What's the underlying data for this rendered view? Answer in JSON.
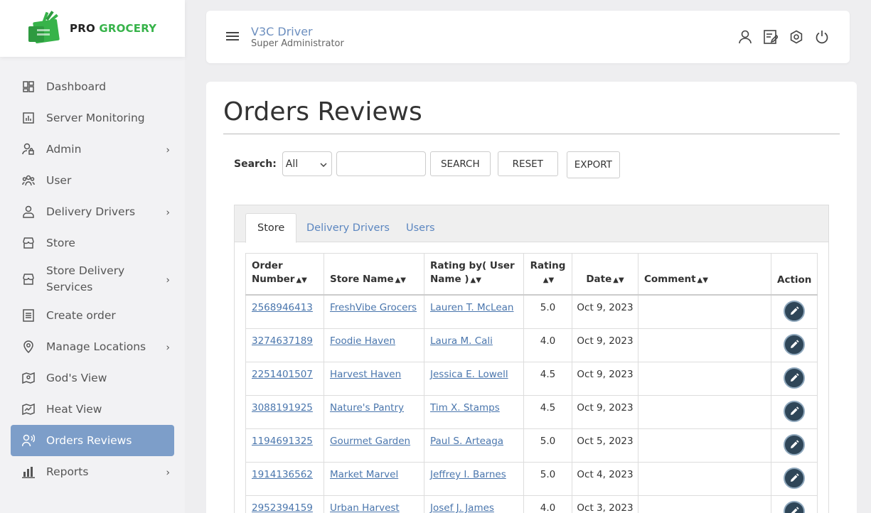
{
  "brand": {
    "word1": "PRO",
    "word2": "GROCERY",
    "color_green": "#37b34a"
  },
  "header": {
    "title": "V3C Driver",
    "subtitle": "Super Administrator",
    "icons": [
      "user-icon",
      "edit-note-icon",
      "settings-icon",
      "power-icon"
    ]
  },
  "sidebar": {
    "items": [
      {
        "label": "Dashboard",
        "icon": "dashboard-icon",
        "submenu": false
      },
      {
        "label": "Server Monitoring",
        "icon": "monitor-chart-icon",
        "submenu": false
      },
      {
        "label": "Admin",
        "icon": "admin-user-icon",
        "submenu": true
      },
      {
        "label": "User",
        "icon": "users-icon",
        "submenu": false
      },
      {
        "label": "Delivery Drivers",
        "icon": "driver-icon",
        "submenu": true
      },
      {
        "label": "Store",
        "icon": "store-icon",
        "submenu": false
      },
      {
        "label": "Store Delivery Services",
        "icon": "store-delivery-icon",
        "submenu": true
      },
      {
        "label": "Create order",
        "icon": "order-list-icon",
        "submenu": false
      },
      {
        "label": "Manage Locations",
        "icon": "location-pin-icon",
        "submenu": true
      },
      {
        "label": "God's View",
        "icon": "map-view-icon",
        "submenu": false
      },
      {
        "label": "Heat View",
        "icon": "heat-map-icon",
        "submenu": false
      },
      {
        "label": "Orders Reviews",
        "icon": "review-icon",
        "submenu": false,
        "active": true
      },
      {
        "label": "Reports",
        "icon": "reports-icon",
        "submenu": true
      }
    ],
    "active_color": "#7d9ec9"
  },
  "main": {
    "title": "Orders Reviews",
    "search": {
      "label": "Search:",
      "select_value": "All",
      "input_value": "",
      "search_btn": "SEARCH",
      "reset_btn": "RESET",
      "export_btn": "EXPORT"
    },
    "tabs": [
      {
        "label": "Store",
        "active": true
      },
      {
        "label": "Delivery Drivers",
        "active": false
      },
      {
        "label": "Users",
        "active": false
      }
    ],
    "table": {
      "headers": {
        "order_number": "Order Number",
        "store_name": "Store Name",
        "rating_by": "Rating by( User Name )",
        "rating": "Rating",
        "date": "Date",
        "comment": "Comment",
        "action": "Action"
      },
      "rows": [
        {
          "order": "2568946413",
          "store": "FreshVibe Grocers",
          "user": "Lauren T. McLean",
          "rating": "5.0",
          "date": "Oct 9, 2023",
          "comment": ""
        },
        {
          "order": "3274637189",
          "store": "Foodie Haven",
          "user": "Laura M. Cali",
          "rating": "4.0",
          "date": "Oct 9, 2023",
          "comment": ""
        },
        {
          "order": "2251401507",
          "store": "Harvest Haven",
          "user": "Jessica E. Lowell",
          "rating": "4.5",
          "date": "Oct 9, 2023",
          "comment": ""
        },
        {
          "order": "3088191925",
          "store": "Nature's Pantry",
          "user": "Tim X. Stamps",
          "rating": "4.5",
          "date": "Oct 9, 2023",
          "comment": ""
        },
        {
          "order": "1194691325",
          "store": "Gourmet Garden",
          "user": "Paul S. Arteaga",
          "rating": "5.0",
          "date": "Oct 5, 2023",
          "comment": ""
        },
        {
          "order": "1914136562",
          "store": "Market Marvel",
          "user": "Jeffrey I. Barnes",
          "rating": "5.0",
          "date": "Oct 4, 2023",
          "comment": ""
        },
        {
          "order": "2952394159",
          "store": "Urban Harvest",
          "user": "Josef J. James",
          "rating": "4.0",
          "date": "Oct 3, 2023",
          "comment": ""
        }
      ]
    }
  }
}
